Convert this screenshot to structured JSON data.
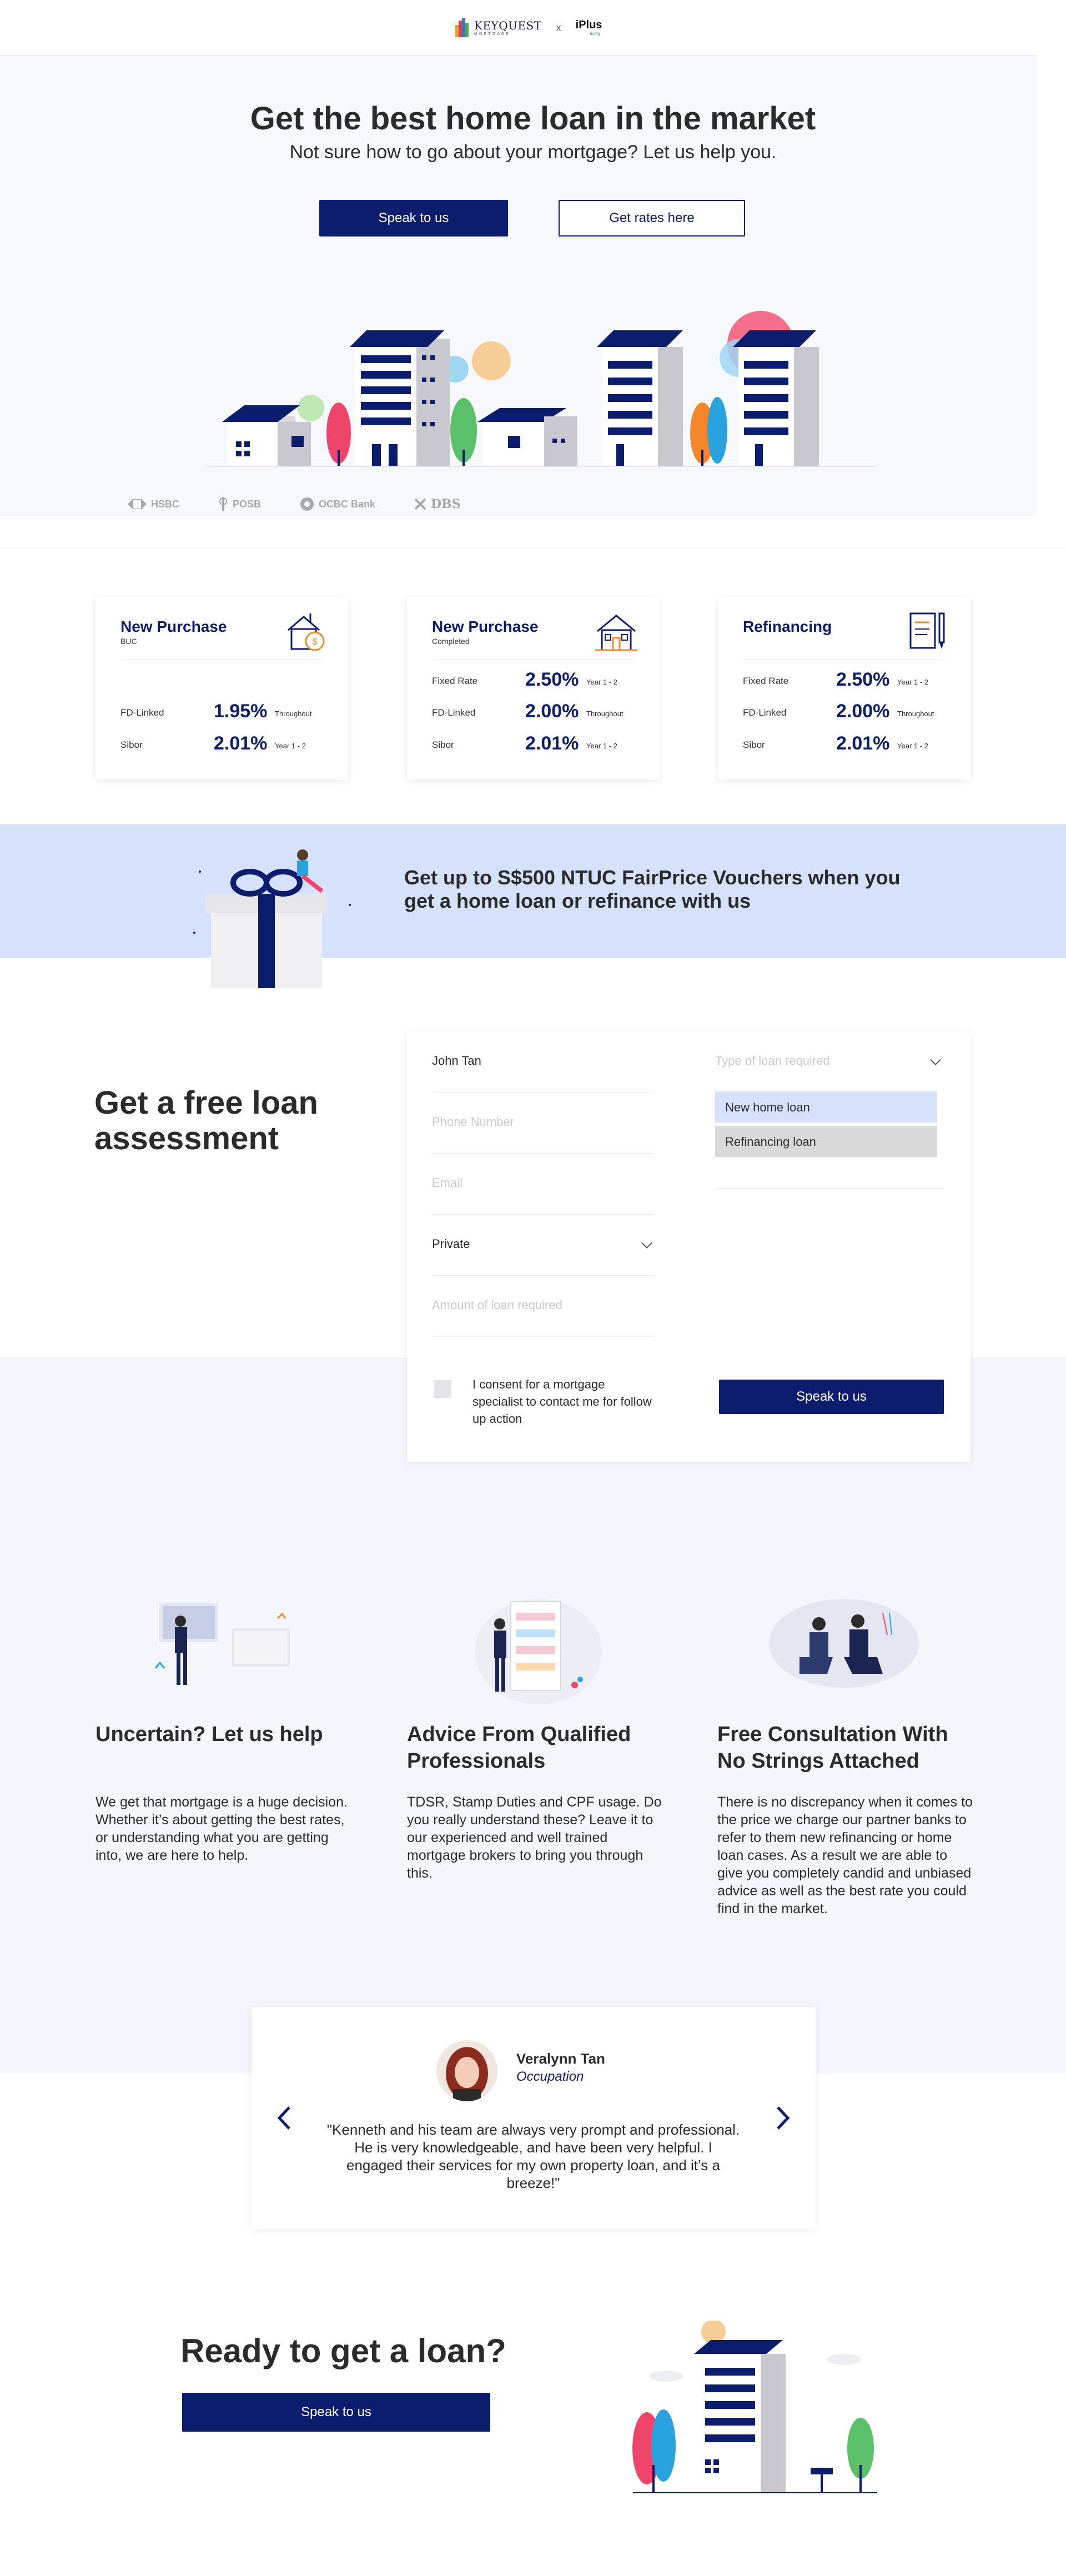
{
  "header": {
    "brand_primary": "KEYQUEST",
    "brand_primary_tag": "MORTGAGE",
    "separator": "x",
    "brand_partner": "iPlus",
    "brand_partner_tag": "living"
  },
  "hero": {
    "title": "Get the best home loan in the market",
    "subtitle": "Not sure how to go about your mortgage? Let us help you.",
    "primary_cta": "Speak to us",
    "secondary_cta": "Get rates here",
    "banks": [
      "HSBC",
      "POSB",
      "OCBC Bank",
      "DBS"
    ]
  },
  "rate_cards": [
    {
      "title": "New Purchase",
      "subtitle": "BUC",
      "icon": "house-coin-icon",
      "rows": [
        {
          "label": "FD-Linked",
          "value": "1.95%",
          "note": "Throughout"
        },
        {
          "label": "Sibor",
          "value": "2.01%",
          "note": "Year 1 - 2"
        }
      ]
    },
    {
      "title": "New Purchase",
      "subtitle": "Completed",
      "icon": "house-icon",
      "rows": [
        {
          "label": "Fixed Rate",
          "value": "2.50%",
          "note": "Year 1 - 2"
        },
        {
          "label": "FD-Linked",
          "value": "2.00%",
          "note": "Throughout"
        },
        {
          "label": "Sibor",
          "value": "2.01%",
          "note": "Year 1 - 2"
        }
      ]
    },
    {
      "title": "Refinancing",
      "subtitle": "",
      "icon": "document-pen-icon",
      "rows": [
        {
          "label": "Fixed Rate",
          "value": "2.50%",
          "note": "Year 1 - 2"
        },
        {
          "label": "FD-Linked",
          "value": "2.00%",
          "note": "Throughout"
        },
        {
          "label": "Sibor",
          "value": "2.01%",
          "note": "Year 1 - 2"
        }
      ]
    }
  ],
  "promo": {
    "text": "Get up to S$500 NTUC FairPrice Vouchers when you get a home loan or refinance with us"
  },
  "assessment": {
    "title": "Get a free loan assessment",
    "name_value": "John Tan",
    "phone_placeholder": "Phone Number",
    "email_placeholder": "Email",
    "property_value": "Private",
    "amount_placeholder": "Amount of loan required",
    "loan_type_placeholder": "Type of loan required",
    "loan_type_options": [
      "New home loan",
      "Refinancing loan"
    ],
    "consent_text": "I consent for a mortgage specialist to contact me for follow up action",
    "submit_label": "Speak to us"
  },
  "features": [
    {
      "title": "Uncertain? Let us help",
      "body": "We get that mortgage is a huge decision. Whether it’s about getting the best rates, or understanding what you are getting into, we are here to help."
    },
    {
      "title": "Advice From Qualified Professionals",
      "body": "TDSR, Stamp Duties and CPF usage. Do you really understand these? Leave it to our experienced and well trained mortgage brokers to bring you through this."
    },
    {
      "title": "Free Consultation With No Strings Attached",
      "body": "There is no discrepancy when it comes to the price we charge our partner banks to refer to them new refinancing or home loan cases. As a result we are able to give you completely candid and unbiased advice as well as the best rate you could find in the market."
    }
  ],
  "testimonial": {
    "name": "Veralynn Tan",
    "occupation": "Occupation",
    "quote": "\"Kenneth and his team are always very prompt and professional. He is very knowledgeable, and have been very helpful. I engaged their services for my own property loan, and it’s a breeze!\""
  },
  "cta": {
    "title": "Ready to get a loan?",
    "button": "Speak to us"
  },
  "colors": {
    "brand_navy": "#0d1d6e",
    "promo_bg": "#d6e2fb",
    "hero_bg": "#f7f8fc",
    "dropdown_selected": "#d6e2fb",
    "dropdown_other": "#d9d9d9"
  }
}
